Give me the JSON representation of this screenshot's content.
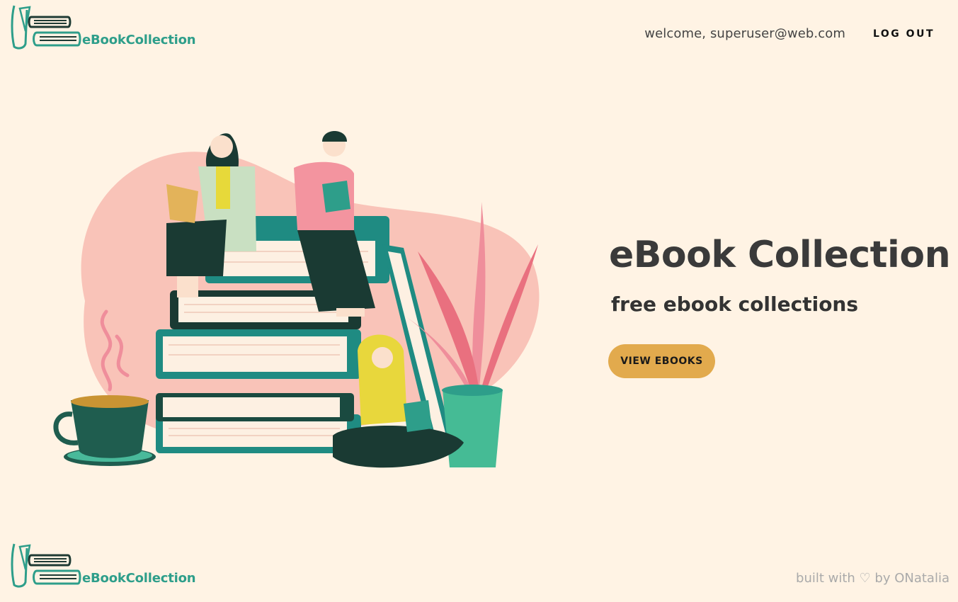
{
  "header": {
    "logo_text": "eBookCollection",
    "welcome_text": "welcome, superuser@web.com",
    "logout_label": "LOG OUT"
  },
  "hero": {
    "title": "eBook Collection",
    "subtitle": "free ebook collections",
    "button_label": "VIEW EBOOKS"
  },
  "footer": {
    "logo_text": "eBookCollection",
    "credit_text": "built with ♡ by ONatalia"
  },
  "colors": {
    "background": "#fff3e4",
    "brand_teal": "#2e9e8a",
    "button": "#e2aa4d",
    "blob_pink": "#f9c3b8"
  },
  "icons": [
    "books-logo-icon",
    "heart-icon"
  ]
}
